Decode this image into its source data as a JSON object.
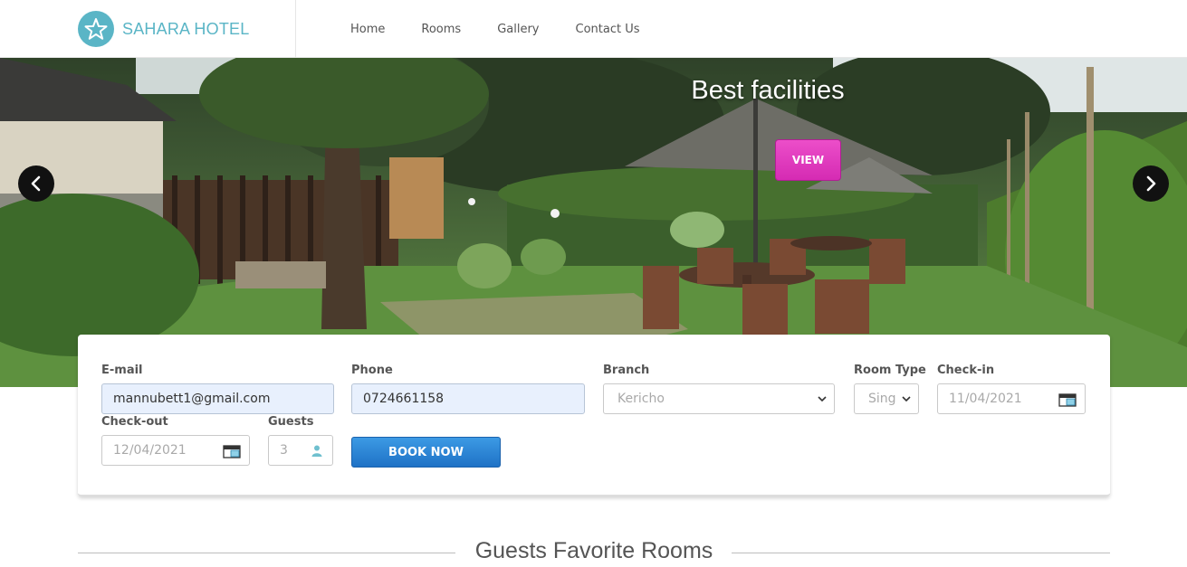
{
  "brand": {
    "name": "SAHARA HOTEL",
    "logo_icon": "star-icon",
    "color": "#5ab5c6"
  },
  "nav": {
    "items": [
      "Home",
      "Rooms",
      "Gallery",
      "Contact Us"
    ]
  },
  "hero": {
    "title": "Best facilities",
    "view_label": "VIEW",
    "prev_icon": "chevron-left-icon",
    "next_icon": "chevron-right-icon"
  },
  "booking": {
    "email": {
      "label": "E-mail",
      "value": "mannubett1@gmail.com"
    },
    "phone": {
      "label": "Phone",
      "value": "0724661158"
    },
    "branch": {
      "label": "Branch",
      "value": "Kericho"
    },
    "room_type": {
      "label": "Room Type",
      "value": "Sing"
    },
    "checkin": {
      "label": "Check-in",
      "value": "11/04/2021"
    },
    "checkout": {
      "label": "Check-out",
      "value": "12/04/2021"
    },
    "guests": {
      "label": "Guests",
      "value": "3"
    },
    "book_label": "BOOK NOW",
    "accent": "#1f72c6"
  },
  "section": {
    "title": "Guests Favorite Rooms"
  }
}
